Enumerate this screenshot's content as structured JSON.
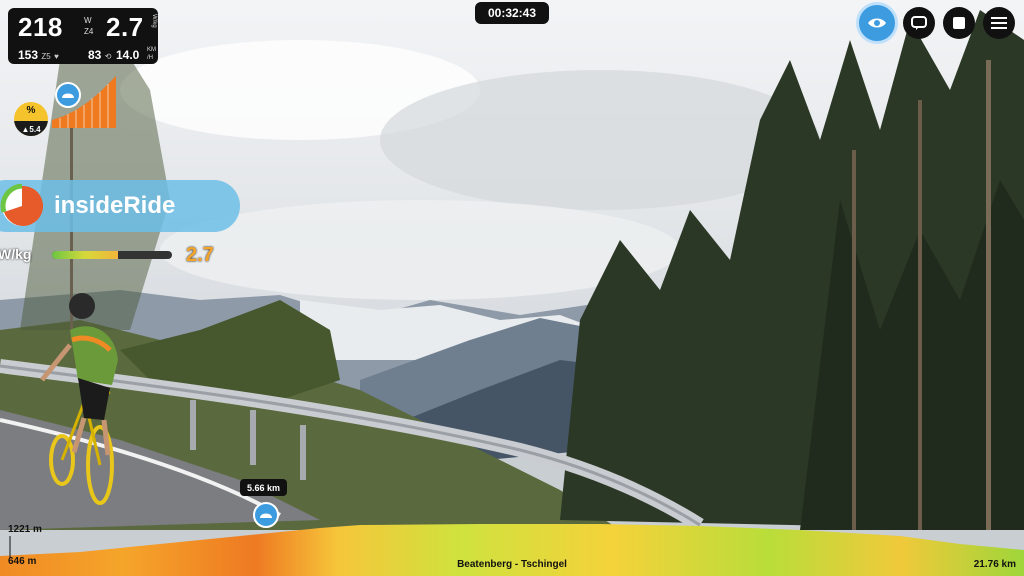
{
  "stats": {
    "power": "218",
    "power_unit_top": "W",
    "power_unit_bottom": "Z4",
    "wkg": "2.7",
    "wkg_unit": "W/kg",
    "heart_rate": "153",
    "hr_zone": "Z5",
    "cadence": "83",
    "speed": "14.0",
    "speed_unit_top": "KM",
    "speed_unit_bottom": "/H"
  },
  "timer": "00:32:43",
  "controls": [
    "view-toggle",
    "chat",
    "stop",
    "menu"
  ],
  "grade": {
    "symbol": "%",
    "value": "5.4"
  },
  "overlay": {
    "brand": "insideRide",
    "wkg_label": "W/kg",
    "wkg_value": "2.7",
    "wkg_level": 0.55
  },
  "marker": {
    "distance": "5.66 km"
  },
  "profile": {
    "elev_max": "1221 m",
    "elev_min": "646 m",
    "route_name": "Beatenberg - Tschingel",
    "total_distance": "21.76 km",
    "progress": 0.26
  },
  "colors": {
    "accent": "#3d9be0",
    "wkg_value": "#f5a52a"
  }
}
